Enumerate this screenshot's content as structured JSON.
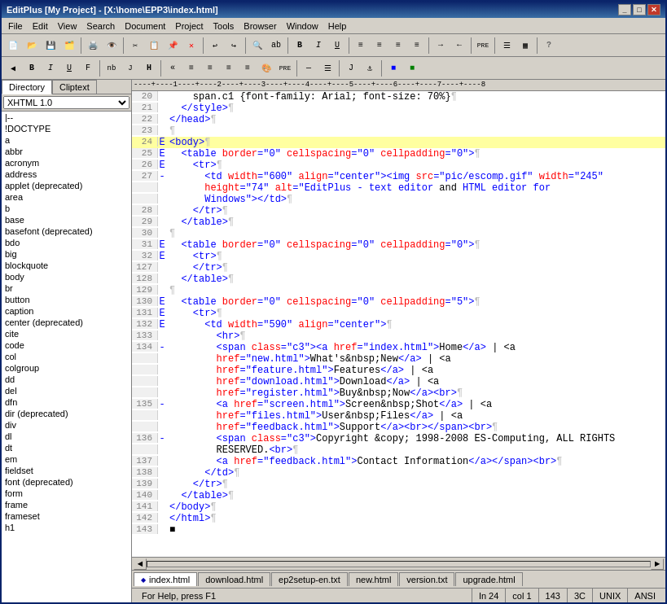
{
  "titleBar": {
    "title": "EditPlus [My Project] - [X:\\home\\EPP3\\index.html]",
    "buttons": [
      "_",
      "□",
      "✕"
    ]
  },
  "menuBar": {
    "items": [
      "File",
      "Edit",
      "View",
      "Search",
      "Document",
      "Project",
      "Tools",
      "Browser",
      "Window",
      "Help"
    ]
  },
  "panels": {
    "tabs": [
      "Directory",
      "Cliptext"
    ],
    "activeTab": "Directory",
    "dropdown": "XHTML 1.0",
    "directoryItems": [
      "|--",
      "!DOCTYPE",
      "a",
      "abbr",
      "acronym",
      "address",
      "applet (deprecated)",
      "area",
      "b",
      "base",
      "basefont (deprecated)",
      "bdo",
      "big",
      "blockquote",
      "body",
      "br",
      "button",
      "caption",
      "center (deprecated)",
      "cite",
      "code",
      "col",
      "colgroup",
      "dd",
      "del",
      "dfn",
      "dir (deprecated)",
      "div",
      "dl",
      "dt",
      "em",
      "fieldset",
      "font (deprecated)",
      "form",
      "frame",
      "frameset",
      "h1"
    ]
  },
  "ruler": "----+----1----+----2----+----3----+----4----+----5----+----6----+----7----+----8",
  "codeLines": [
    {
      "num": "20",
      "arrow": "",
      "content": "    span.c1 {font-family: Arial; font-size: 70%}¶",
      "type": "code"
    },
    {
      "num": "21",
      "arrow": "",
      "content": "  </style>¶",
      "type": "tag"
    },
    {
      "num": "22",
      "arrow": "",
      "content": "</head>¶",
      "type": "tag"
    },
    {
      "num": "23",
      "arrow": "",
      "content": "¶",
      "type": "empty"
    },
    {
      "num": "24",
      "arrow": "E",
      "content": "<body>¶",
      "type": "body",
      "highlight": true
    },
    {
      "num": "25",
      "arrow": "E",
      "content": "  <table border=\"0\" cellspacing=\"0\" cellpadding=\"0\">¶",
      "type": "tag"
    },
    {
      "num": "26",
      "arrow": "E",
      "content": "    <tr>¶",
      "type": "tag"
    },
    {
      "num": "27",
      "arrow": "-",
      "content": "      <td width=\"600\" align=\"center\"><img src=\"pic/escomp.gif\" width=\"245\"",
      "type": "tag"
    },
    {
      "num": "",
      "arrow": "",
      "content": "      height=\"74\" alt=\"EditPlus - text editor and HTML editor for",
      "type": "text"
    },
    {
      "num": "",
      "arrow": "",
      "content": "      Windows\"></td>¶",
      "type": "tag"
    },
    {
      "num": "28",
      "arrow": "",
      "content": "    </tr>¶",
      "type": "tag"
    },
    {
      "num": "29",
      "arrow": "",
      "content": "  </table>¶",
      "type": "tag"
    },
    {
      "num": "30",
      "arrow": "",
      "content": "¶",
      "type": "empty"
    },
    {
      "num": "31",
      "arrow": "E",
      "content": "  <table border=\"0\" cellspacing=\"0\" cellpadding=\"0\">¶",
      "type": "tag"
    },
    {
      "num": "32",
      "arrow": "E",
      "content": "    <tr>¶",
      "type": "tag"
    },
    {
      "num": "127",
      "arrow": "",
      "content": "    </tr>¶",
      "type": "tag"
    },
    {
      "num": "128",
      "arrow": "",
      "content": "  </table>¶",
      "type": "tag"
    },
    {
      "num": "129",
      "arrow": "",
      "content": "¶",
      "type": "empty"
    },
    {
      "num": "130",
      "arrow": "E",
      "content": "  <table border=\"0\" cellspacing=\"0\" cellpadding=\"5\">¶",
      "type": "tag"
    },
    {
      "num": "131",
      "arrow": "E",
      "content": "    <tr>¶",
      "type": "tag"
    },
    {
      "num": "132",
      "arrow": "E",
      "content": "      <td width=\"590\" align=\"center\">¶",
      "type": "tag"
    },
    {
      "num": "133",
      "arrow": "",
      "content": "        <hr>¶",
      "type": "tag"
    },
    {
      "num": "134",
      "arrow": "-",
      "content": "        <span class=\"c3\"><a href=\"index.html\">Home</a> | <a",
      "type": "tag"
    },
    {
      "num": "",
      "arrow": "",
      "content": "        href=\"new.html\">What's&nbsp;New</a> | <a",
      "type": "tag"
    },
    {
      "num": "",
      "arrow": "",
      "content": "        href=\"feature.html\">Features</a> | <a",
      "type": "tag"
    },
    {
      "num": "",
      "arrow": "",
      "content": "        href=\"download.html\">Download</a> | <a",
      "type": "tag"
    },
    {
      "num": "",
      "arrow": "",
      "content": "        href=\"register.html\">Buy&nbsp;Now</a><br>¶",
      "type": "tag"
    },
    {
      "num": "135",
      "arrow": "-",
      "content": "        <a href=\"screen.html\">Screen&nbsp;Shot</a> | <a",
      "type": "tag"
    },
    {
      "num": "",
      "arrow": "",
      "content": "        href=\"files.html\">User&nbsp;Files</a> | <a",
      "type": "tag"
    },
    {
      "num": "",
      "arrow": "",
      "content": "        href=\"feedback.html\">Support</a><br></span><br>¶",
      "type": "tag"
    },
    {
      "num": "136",
      "arrow": "-",
      "content": "        <span class=\"c3\">Copyright &copy; 1998-2008 ES-Computing, ALL RIGHTS",
      "type": "tag"
    },
    {
      "num": "",
      "arrow": "",
      "content": "        RESERVED.<br>¶",
      "type": "tag"
    },
    {
      "num": "137",
      "arrow": "",
      "content": "        <a href=\"feedback.html\">Contact Information</a></span><br>¶",
      "type": "tag"
    },
    {
      "num": "138",
      "arrow": "",
      "content": "      </td>¶",
      "type": "tag"
    },
    {
      "num": "139",
      "arrow": "",
      "content": "    </tr>¶",
      "type": "tag"
    },
    {
      "num": "140",
      "arrow": "",
      "content": "  </table>¶",
      "type": "tag"
    },
    {
      "num": "141",
      "arrow": "",
      "content": "</body>¶",
      "type": "tag"
    },
    {
      "num": "142",
      "arrow": "",
      "content": "</html>¶",
      "type": "tag"
    },
    {
      "num": "143",
      "arrow": "",
      "content": "∎",
      "type": "end"
    }
  ],
  "tabs": [
    {
      "label": "index.html",
      "active": true,
      "dot": true
    },
    {
      "label": "download.html",
      "active": false,
      "dot": false
    },
    {
      "label": "ep2setup-en.txt",
      "active": false,
      "dot": false
    },
    {
      "label": "new.html",
      "active": false,
      "dot": false
    },
    {
      "label": "version.txt",
      "active": false,
      "dot": false
    },
    {
      "label": "upgrade.html",
      "active": false,
      "dot": false
    }
  ],
  "statusBar": {
    "help": "For Help, press F1",
    "position": "In 24",
    "col": "col 1",
    "chars": "143",
    "encoding1": "3C",
    "lineEnd": "UNIX",
    "encoding2": "ANSI"
  }
}
